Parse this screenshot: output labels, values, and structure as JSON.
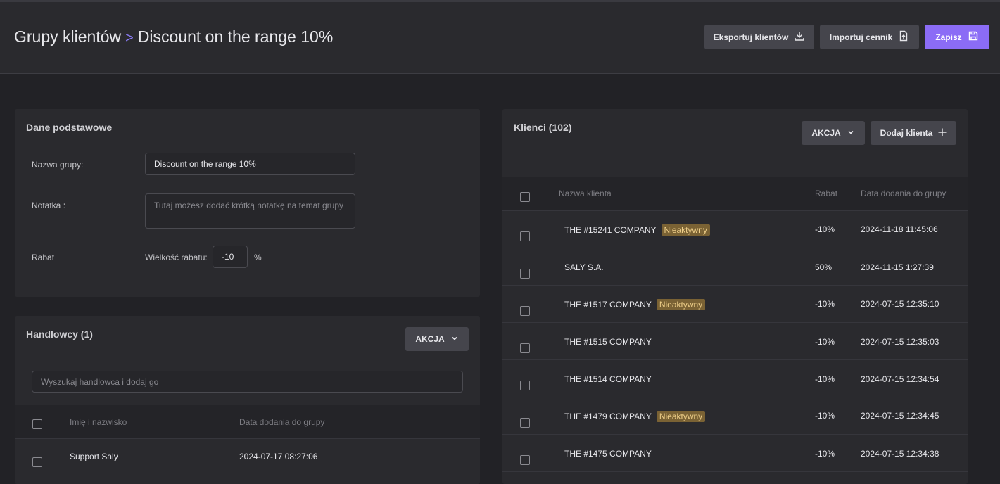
{
  "header": {
    "breadcrumb_parent": "Grupy klientów",
    "breadcrumb_separator": ">",
    "breadcrumb_current": "Discount on the range 10%",
    "export_label": "Eksportuj klientów",
    "import_label": "Importuj cennik",
    "save_label": "Zapisz",
    "icons": {
      "export": "download-icon",
      "import": "file-upload-icon",
      "save": "floppy-disk-icon"
    }
  },
  "basic": {
    "title": "Dane podstawowe",
    "name_label": "Nazwa grupy:",
    "name_value": "Discount on the range 10%",
    "note_label": "Notatka :",
    "note_placeholder": "Tutaj możesz dodać krótką notatkę na temat grupy",
    "discount_label": "Rabat",
    "discount_size_label": "Wielkość rabatu:",
    "discount_value": "-10",
    "discount_unit": "%"
  },
  "sellers": {
    "title": "Handlowcy (1)",
    "action_label": "AKCJA",
    "search_placeholder": "Wyszukaj handlowca i dodaj go",
    "columns": [
      "Imię i nazwisko",
      "Data dodania do grupy"
    ],
    "rows": [
      {
        "name": "Support Saly",
        "date": "2024-07-17 08:27:06"
      }
    ]
  },
  "clients": {
    "title": "Klienci (102)",
    "action_label": "AKCJA",
    "add_label": "Dodaj klienta",
    "columns": [
      "Nazwa klienta",
      "Rabat",
      "Data dodania do grupy"
    ],
    "rows": [
      {
        "name": "THE #15241 COMPANY",
        "badge": "Nieaktywny",
        "discount": "-10%",
        "date": "2024-11-18 11:45:06"
      },
      {
        "name": "SALY S.A.",
        "badge": "",
        "discount": "50%",
        "date": "2024-11-15 1:27:39"
      },
      {
        "name": "THE #1517 COMPANY",
        "badge": "Nieaktywny",
        "discount": "-10%",
        "date": "2024-07-15 12:35:10"
      },
      {
        "name": "THE #1515 COMPANY",
        "badge": "",
        "discount": "-10%",
        "date": "2024-07-15 12:35:03"
      },
      {
        "name": "THE #1514 COMPANY",
        "badge": "",
        "discount": "-10%",
        "date": "2024-07-15 12:34:54"
      },
      {
        "name": "THE #1479 COMPANY",
        "badge": "Nieaktywny",
        "discount": "-10%",
        "date": "2024-07-15 12:34:45"
      },
      {
        "name": "THE #1475 COMPANY",
        "badge": "",
        "discount": "-10%",
        "date": "2024-07-15 12:34:38"
      }
    ]
  },
  "colors": {
    "accent": "#8b6cf6",
    "badge_bg": "#7a6234",
    "badge_text": "#f0d08a"
  }
}
